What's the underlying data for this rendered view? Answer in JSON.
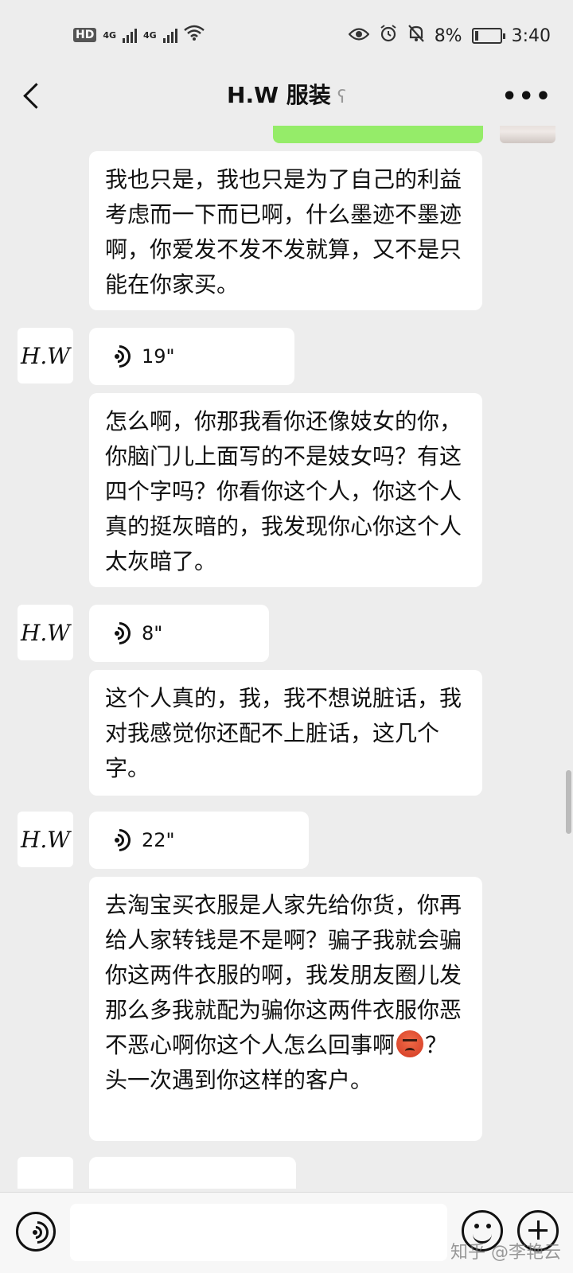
{
  "status_bar": {
    "network_left": "4G",
    "network_right": "4G",
    "battery_percent": "8%",
    "time": "3:40"
  },
  "header": {
    "title": "H.W 服装"
  },
  "messages": [
    {
      "type": "text",
      "text": "我也只是，我也只是为了自己的利益考虑而一下而已啊，什么墨迹不墨迹啊，你爱发不发不发就算，又不是只能在你家买。"
    },
    {
      "type": "voice",
      "avatar": "H.W",
      "duration": "19\""
    },
    {
      "type": "text",
      "text": "怎么啊，你那我看你还像妓女的你，你脑门儿上面写的不是妓女吗？有这四个字吗？你看你这个人，你这个人真的挺灰暗的，我发现你心你这个人太灰暗了。"
    },
    {
      "type": "voice",
      "avatar": "H.W",
      "duration": "8\""
    },
    {
      "type": "text",
      "text": "这个人真的，我，我不想说脏话，我对我感觉你还配不上脏话，这几个字。"
    },
    {
      "type": "voice",
      "avatar": "H.W",
      "duration": "22\""
    },
    {
      "type": "text",
      "text_before_emoji": "去淘宝买衣服是人家先给你货，你再给人家转钱是不是啊？骗子我就会骗你这两件衣服的啊，我发朋友圈儿发那么多我就配为骗你这两件衣服你恶不恶心啊你这个人怎么回事啊",
      "emoji": "angry-face",
      "text_after_emoji": "？头一次遇到你这样的客户。"
    }
  ],
  "input": {
    "value": "",
    "placeholder": ""
  },
  "watermark": "知乎 @李艳云"
}
